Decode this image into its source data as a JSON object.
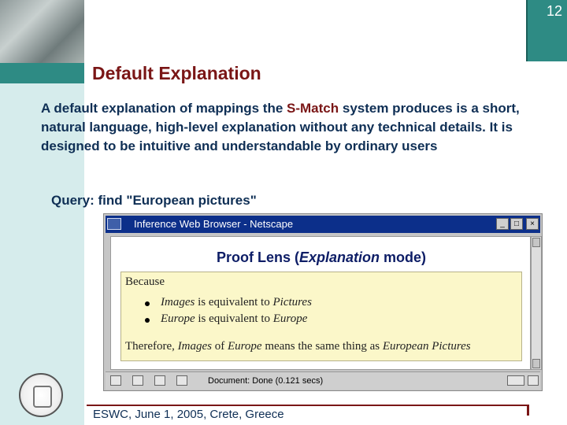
{
  "slide": {
    "page_number": "12",
    "title": "Default Explanation",
    "body_before": "A default explanation of mappings the ",
    "body_highlight": "S-Match",
    "body_after": " system produces is a short, natural language, high-level explanation without any technical details. It is designed to be intuitive and understandable by ordinary users",
    "query": "Query: find  \"European pictures\"",
    "footer": "ESWC, June 1, 2005, Crete, Greece"
  },
  "browser": {
    "window_title": "Inference Web Browser - Netscape",
    "lens_title_start": "Proof Lens (",
    "lens_title_italic": "Explanation",
    "lens_title_end": " mode)",
    "because": "Because",
    "bullet1_term": "Images",
    "bullet1_mid": " is equivalent to ",
    "bullet1_target": "Pictures",
    "bullet2_term": "Europe",
    "bullet2_mid": " is equivalent to ",
    "bullet2_target": "Europe",
    "therefore_lead": "Therefore, ",
    "therefore_term1": "Images",
    "therefore_mid1": " of ",
    "therefore_term2": "Europe",
    "therefore_mid2": " means the same thing as ",
    "therefore_term3": "European Pictures",
    "status": "Document: Done (0.121 secs)"
  },
  "colors": {
    "accent": "#2e8b84",
    "title": "#7a1616",
    "text": "#0f2f55",
    "explanation_bg": "#fbf7c9"
  },
  "icons": [
    "fresco-image",
    "university-seal-logo",
    "netscape-icon",
    "minimize-icon",
    "maximize-icon",
    "close-icon",
    "scroll-up-icon",
    "scroll-down-icon"
  ]
}
